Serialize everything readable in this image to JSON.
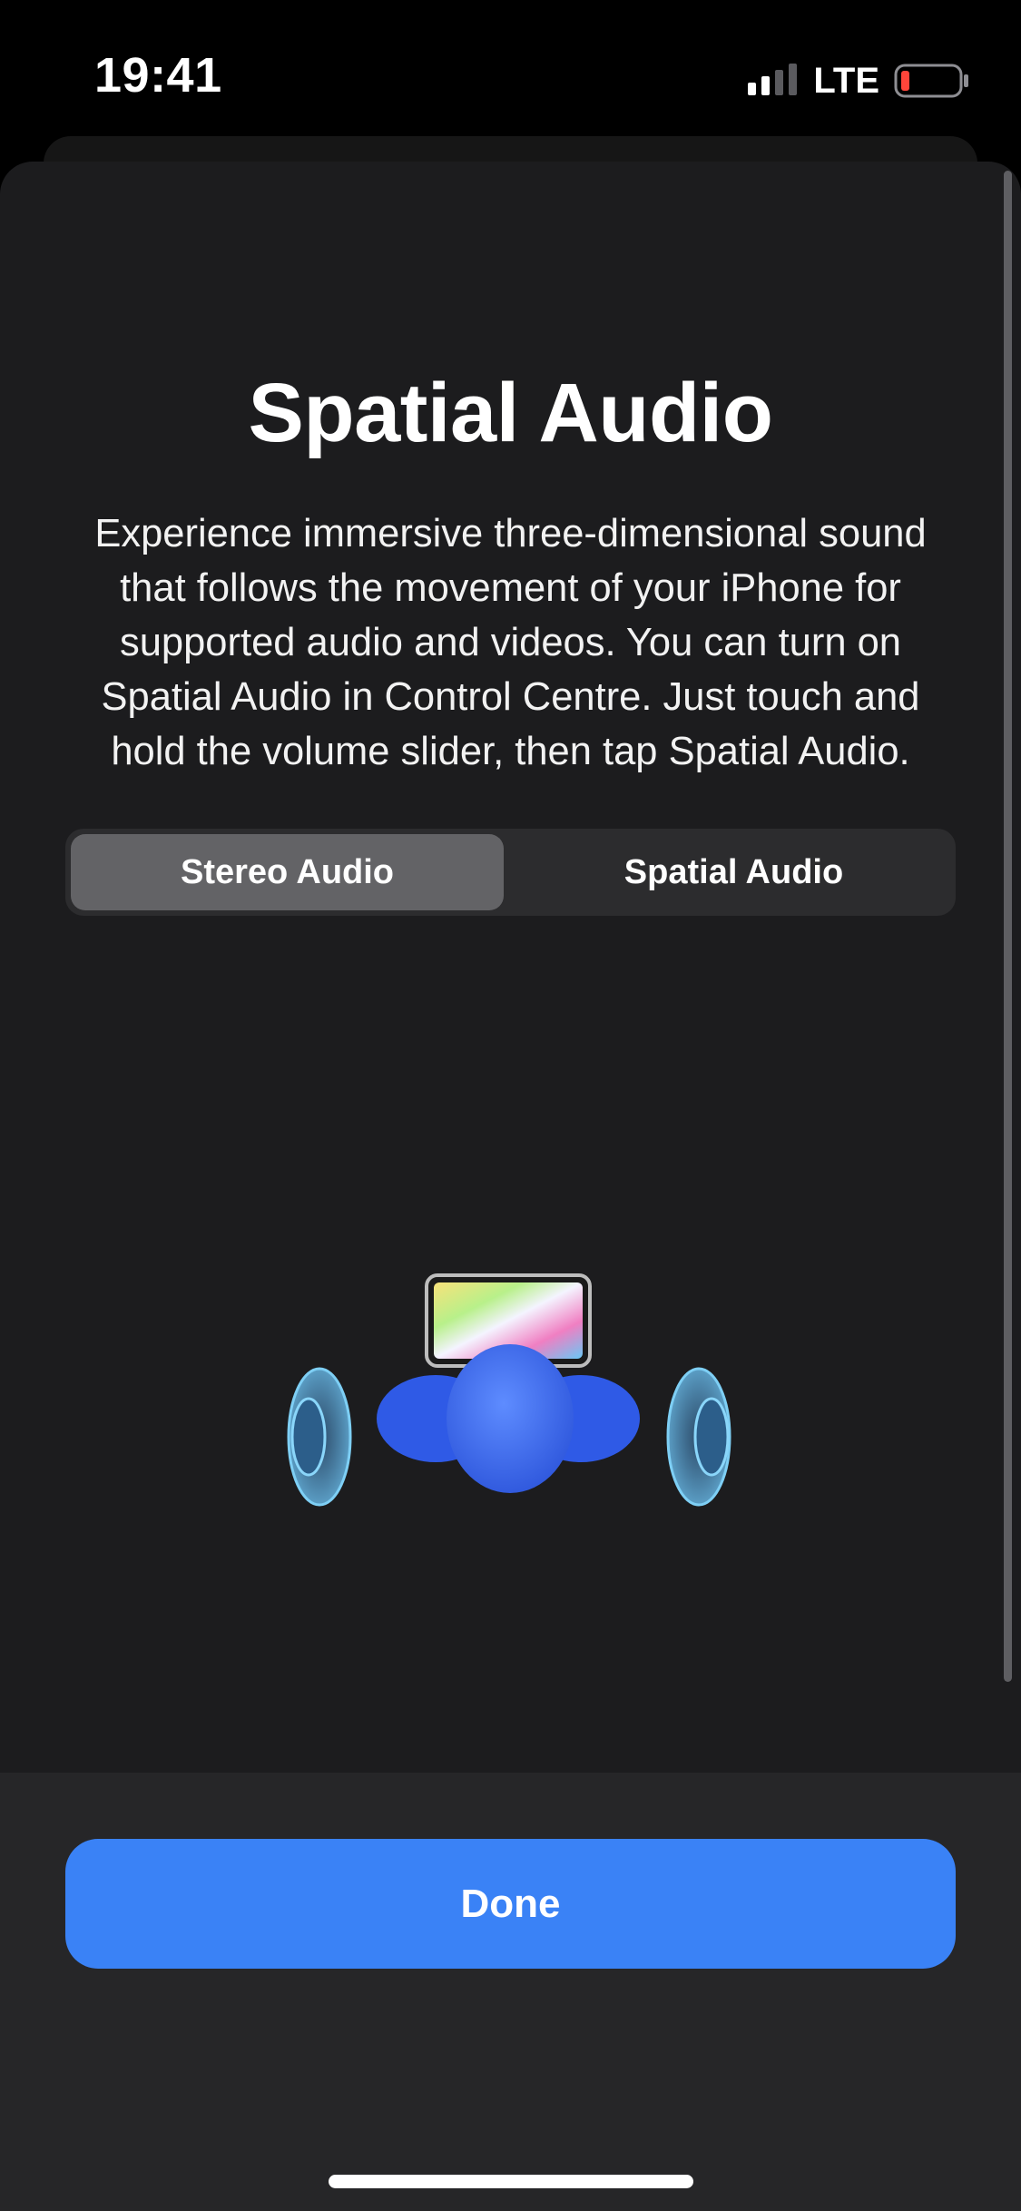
{
  "status_bar": {
    "time": "19:41",
    "network": "LTE",
    "signal_icon": "cellular-signal-icon",
    "battery_icon": "battery-low-icon",
    "battery_color": "#ff453a"
  },
  "sheet": {
    "title": "Spatial Audio",
    "description": "Experience immersive three-dimensional sound that follows the movement of your iPhone for supported audio and videos. You can turn on Spatial Audio in Control Centre. Just touch and hold the volume slider, then tap Spatial Audio.",
    "segmented_control": {
      "options": [
        "Stereo Audio",
        "Spatial Audio"
      ],
      "selected": "Stereo Audio"
    },
    "illustration": {
      "icons": [
        "tv-screen-icon",
        "left-speaker-icon",
        "listener-head-icon",
        "right-speaker-icon"
      ]
    }
  },
  "footer": {
    "done_label": "Done",
    "accent_color": "#3a82f6"
  }
}
